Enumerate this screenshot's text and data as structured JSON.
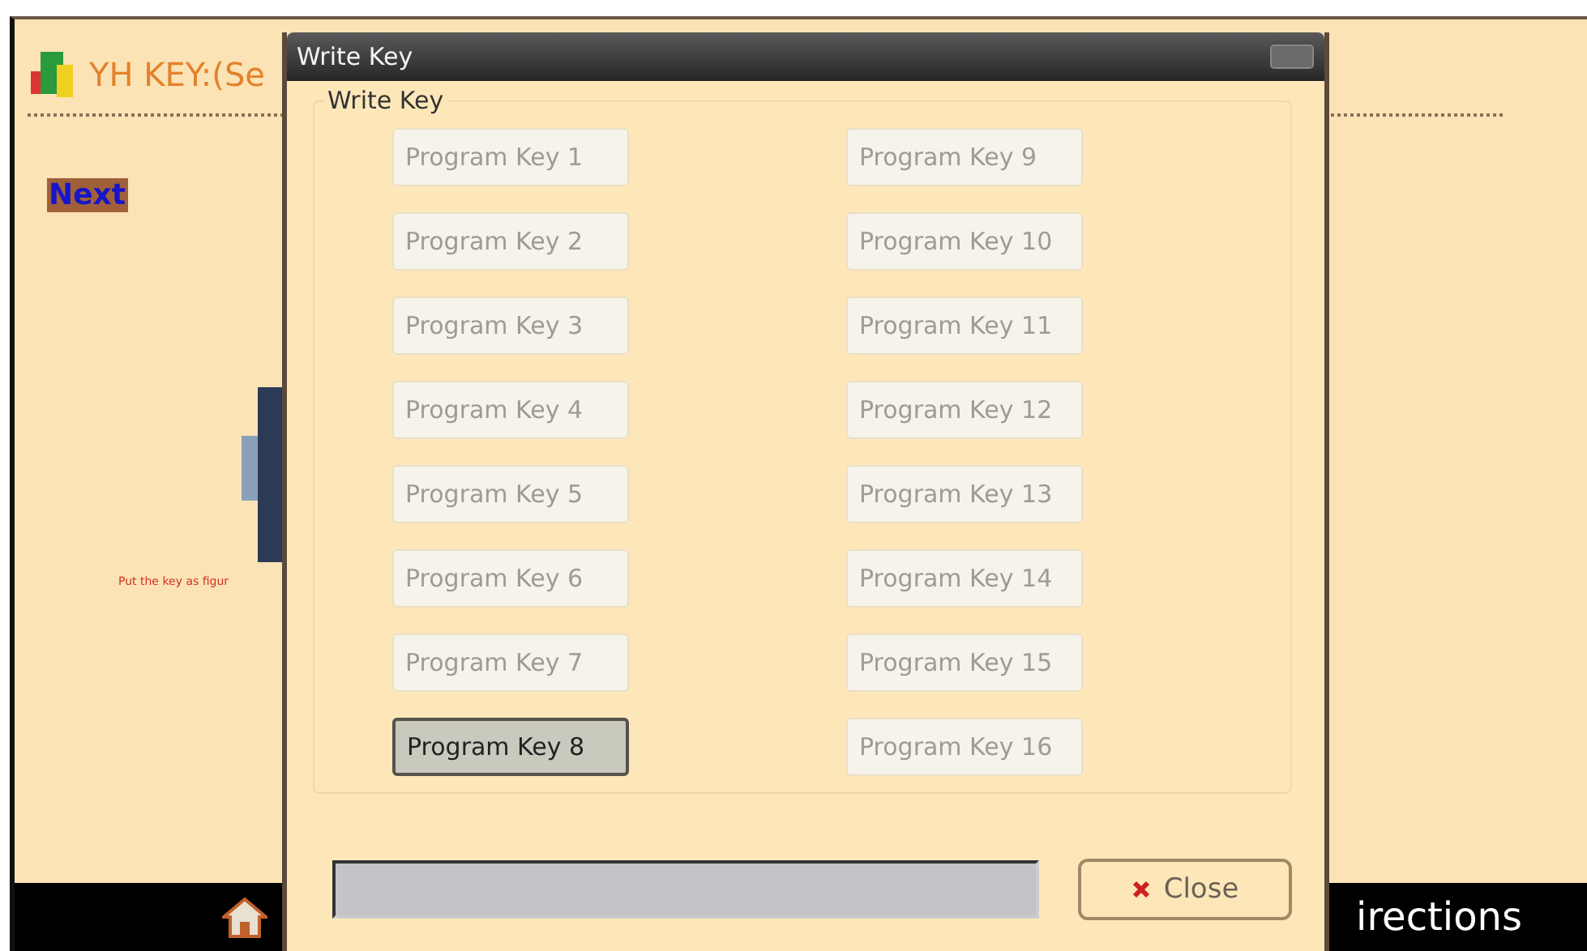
{
  "background_app": {
    "title": "YH KEY:(Se",
    "next_button": "Next",
    "instruction": "Put the key as figur",
    "taskbar": [
      {
        "label": "irections"
      }
    ]
  },
  "dialog": {
    "title": "Write Key",
    "group_label": "Write Key",
    "buttons": [
      {
        "label": "Program Key 1",
        "selected": false
      },
      {
        "label": "Program Key 2",
        "selected": false
      },
      {
        "label": "Program Key 3",
        "selected": false
      },
      {
        "label": "Program Key 4",
        "selected": false
      },
      {
        "label": "Program Key 5",
        "selected": false
      },
      {
        "label": "Program Key 6",
        "selected": false
      },
      {
        "label": "Program Key 7",
        "selected": false
      },
      {
        "label": "Program Key 8",
        "selected": true
      },
      {
        "label": "Program Key 9",
        "selected": false
      },
      {
        "label": "Program Key 10",
        "selected": false
      },
      {
        "label": "Program Key 11",
        "selected": false
      },
      {
        "label": "Program Key 12",
        "selected": false
      },
      {
        "label": "Program Key 13",
        "selected": false
      },
      {
        "label": "Program Key 14",
        "selected": false
      },
      {
        "label": "Program Key 15",
        "selected": false
      },
      {
        "label": "Program Key 16",
        "selected": false
      }
    ],
    "close_button": "Close"
  }
}
